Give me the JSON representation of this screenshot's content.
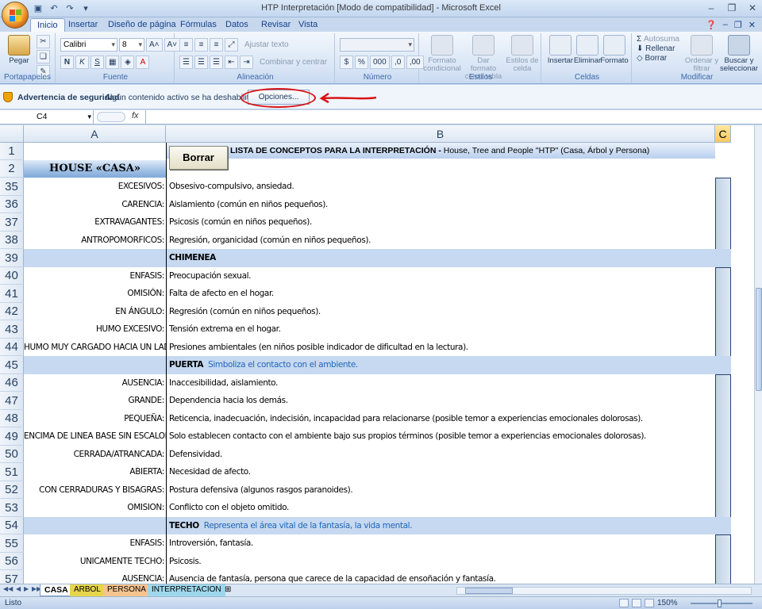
{
  "title": "HTP Interpretación  [Modo de compatibilidad] - Microsoft Excel",
  "tabs": [
    "Inicio",
    "Insertar",
    "Diseño de página",
    "Fórmulas",
    "Datos",
    "Revisar",
    "Vista"
  ],
  "ribbon": {
    "pegar": "Pegar",
    "portapapeles": "Portapapeles",
    "font_name": "Calibri",
    "font_size": "8",
    "fuente": "Fuente",
    "ajustar": "Ajustar texto",
    "combinar": "Combinar y centrar",
    "alineacion": "Alineación",
    "numero": "Número",
    "formato_condicional": "Formato condicional",
    "dar_formato_tabla": "Dar formato como tabla",
    "estilos_celda": "Estilos de celda",
    "estilos": "Estilos",
    "insertar": "Insertar",
    "eliminar": "Eliminar",
    "formato": "Formato",
    "celdas": "Celdas",
    "autosuma": "Autosuma",
    "rellenar": "Rellenar",
    "borrar": "Borrar",
    "ordenar": "Ordenar y filtrar",
    "buscar": "Buscar y seleccionar",
    "modificar": "Modificar"
  },
  "security": {
    "title": "Advertencia de seguridad",
    "message": "Algún contenido activo se ha deshabilitado.",
    "options": "Opciones..."
  },
  "namebox": "C4",
  "fx": "fx",
  "columns": [
    "A",
    "B",
    "C"
  ],
  "header": {
    "house": "HOUSE  «CASA»",
    "borrar_button": "Borrar",
    "title_bold": "LISTA DE CONCEPTOS PARA LA INTERPRETACIÓN  -",
    "title_rest": "  House, Tree and People \"HTP\" (Casa, Árbol y Persona)"
  },
  "rows": [
    {
      "n": "35",
      "a": "EXCESIVOS:",
      "b": "Obsesivo-compulsivo, ansiedad."
    },
    {
      "n": "36",
      "a": "CARENCIA:",
      "b": "Aislamiento (común en niños pequeños)."
    },
    {
      "n": "37",
      "a": "EXTRAVAGANTES:",
      "b": "Psicosis (común en niños pequeños)."
    },
    {
      "n": "38",
      "a": "ANTROPOMORFICOS:",
      "b": "Regresión, organicidad (común en niños pequeños)."
    },
    {
      "n": "39",
      "section": true,
      "a": "",
      "b": "CHIMENEA",
      "sub": ""
    },
    {
      "n": "40",
      "a": "ENFASIS:",
      "b": "Preocupación sexual."
    },
    {
      "n": "41",
      "a": "OMISIÓN:",
      "b": "Falta de afecto en el hogar."
    },
    {
      "n": "42",
      "a": "EN ÁNGULO:",
      "b": "Regresión (común en niños pequeños)."
    },
    {
      "n": "43",
      "a": "HUMO EXCESIVO:",
      "b": "Tensión extrema en el hogar."
    },
    {
      "n": "44",
      "a": "HUMO MUY CARGADO HACIA UN LADO:",
      "b": "Presiones ambientales (en niños posible indicador de dificultad en la lectura)."
    },
    {
      "n": "45",
      "section": true,
      "a": "",
      "b": "PUERTA",
      "sub": "Simboliza el contacto con el ambiente."
    },
    {
      "n": "46",
      "a": "AUSENCIA:",
      "b": "Inaccesibilidad, aislamiento."
    },
    {
      "n": "47",
      "a": "GRANDE:",
      "b": "Dependencia hacia los demás."
    },
    {
      "n": "48",
      "a": "PEQUEÑA:",
      "b": "Reticencia, inadecuación, indecisión, incapacidad para relacionarse  (posible temor a experiencias emocionales dolorosas)."
    },
    {
      "n": "49",
      "a": "ENCIMA DE LINEA BASE SIN ESCALONES:",
      "b": "Solo establecen contacto con el ambiente bajo sus propios términos (posible temor a experiencias emocionales dolorosas)."
    },
    {
      "n": "50",
      "a": "CERRADA/ATRANCADA:",
      "b": "Defensividad."
    },
    {
      "n": "51",
      "a": "ABIERTA:",
      "b": "Necesidad de afecto."
    },
    {
      "n": "52",
      "a": "CON CERRADURAS Y BISAGRAS:",
      "b": "Postura defensiva (algunos rasgos paranoides)."
    },
    {
      "n": "53",
      "a": "OMISION:",
      "b": "Conflicto con el objeto omitido."
    },
    {
      "n": "54",
      "section": true,
      "a": "",
      "b": "TECHO",
      "sub": "Representa el área vital de la fantasía, la vida mental."
    },
    {
      "n": "55",
      "a": "ENFASIS:",
      "b": "Introversión, fantasía."
    },
    {
      "n": "56",
      "a": "UNICAMENTE TECHO:",
      "b": "Psicosis."
    },
    {
      "n": "57",
      "a": "AUSENCIA:",
      "b": "Ausencia de fantasía, persona que carece de la capacidad de ensoñación y fantasía."
    }
  ],
  "sheets": [
    "CASA",
    "ARBOL",
    "PERSONA",
    "INTERPRETACION"
  ],
  "status": "Listo",
  "zoom": "150%",
  "colors": {
    "accent": "#15428b",
    "section": "#c6d9f0",
    "annotation": "#d81414"
  }
}
